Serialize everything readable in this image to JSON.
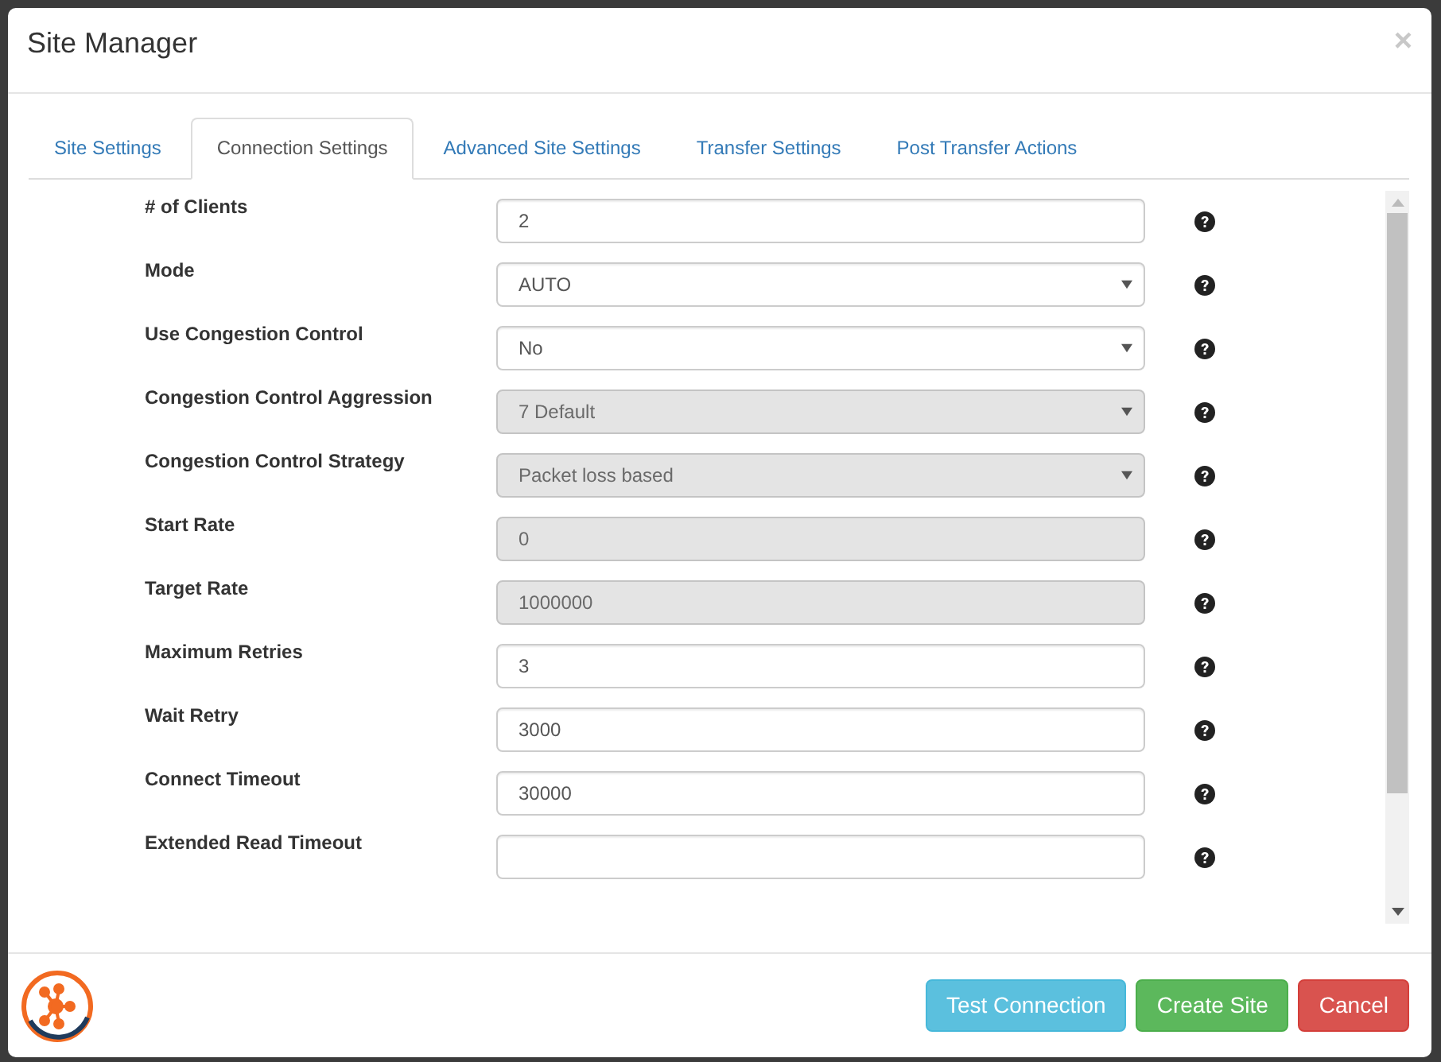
{
  "dialog": {
    "title": "Site Manager",
    "close": "×"
  },
  "tabs": [
    {
      "label": "Site Settings",
      "selected": false
    },
    {
      "label": "Connection Settings",
      "selected": true
    },
    {
      "label": "Advanced Site Settings",
      "selected": false
    },
    {
      "label": "Transfer Settings",
      "selected": false
    },
    {
      "label": "Post Transfer Actions",
      "selected": false
    }
  ],
  "fields": [
    {
      "label": "# of Clients",
      "kind": "text",
      "value": "2",
      "disabled": false
    },
    {
      "label": "Mode",
      "kind": "select",
      "value": "AUTO",
      "disabled": false
    },
    {
      "label": "Use Congestion Control",
      "kind": "select",
      "value": "No",
      "disabled": false
    },
    {
      "label": "Congestion Control Aggression",
      "kind": "select",
      "value": "7 Default",
      "disabled": true
    },
    {
      "label": "Congestion Control Strategy",
      "kind": "select",
      "value": "Packet loss based",
      "disabled": true
    },
    {
      "label": "Start Rate",
      "kind": "text",
      "value": "0",
      "disabled": true
    },
    {
      "label": "Target Rate",
      "kind": "text",
      "value": "1000000",
      "disabled": true
    },
    {
      "label": "Maximum Retries",
      "kind": "text",
      "value": "3",
      "disabled": false
    },
    {
      "label": "Wait Retry",
      "kind": "text",
      "value": "3000",
      "disabled": false
    },
    {
      "label": "Connect Timeout",
      "kind": "text",
      "value": "30000",
      "disabled": false
    },
    {
      "label": "Extended Read Timeout",
      "kind": "text",
      "disabled": false
    }
  ],
  "buttons": [
    {
      "label": "Test Connection",
      "kind": "info"
    },
    {
      "label": "Create Site",
      "kind": "success"
    },
    {
      "label": "Cancel",
      "kind": "danger"
    }
  ]
}
